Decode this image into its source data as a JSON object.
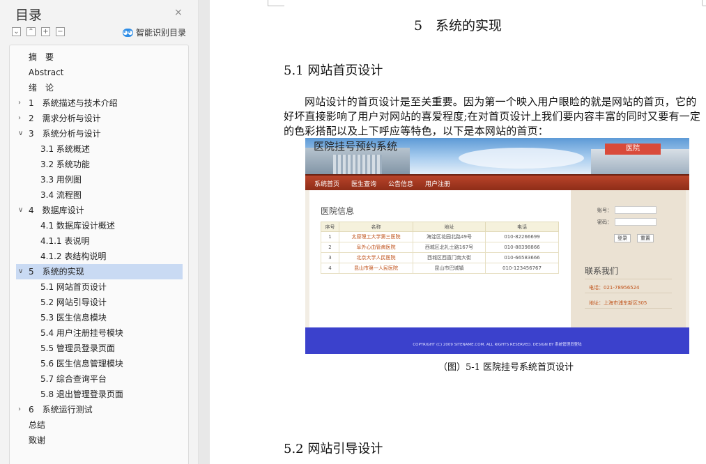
{
  "toc": {
    "title": "目录",
    "close_icon": "×",
    "tool_icons": [
      "collapse-all",
      "expand-all",
      "add-heading",
      "remove-heading"
    ],
    "smart_label": "智能识别目录",
    "items": [
      {
        "label": "摘　要",
        "level": 0,
        "toggle": ""
      },
      {
        "label": "Abstract",
        "level": 0,
        "toggle": ""
      },
      {
        "label": "绪　论",
        "level": 0,
        "toggle": ""
      },
      {
        "label": "1　系统描述与技术介绍",
        "level": 0,
        "toggle": ">"
      },
      {
        "label": "2　需求分析与设计",
        "level": 0,
        "toggle": ">"
      },
      {
        "label": "3　系统分析与设计",
        "level": 0,
        "toggle": "v"
      },
      {
        "label": "3.1  系统概述",
        "level": 1,
        "toggle": ""
      },
      {
        "label": "3.2   系统功能",
        "level": 1,
        "toggle": ""
      },
      {
        "label": "3.3  用例图",
        "level": 1,
        "toggle": ""
      },
      {
        "label": "3.4  流程图",
        "level": 1,
        "toggle": ""
      },
      {
        "label": "4　数据库设计",
        "level": 0,
        "toggle": "v"
      },
      {
        "label": "4.1  数据库设计概述",
        "level": 1,
        "toggle": ""
      },
      {
        "label": "4.1.1  表说明",
        "level": 1,
        "toggle": ""
      },
      {
        "label": "4.1.2  表结构说明",
        "level": 1,
        "toggle": ""
      },
      {
        "label": "5　系统的实现",
        "level": 0,
        "toggle": "v",
        "active": true
      },
      {
        "label": "5.1  网站首页设计",
        "level": 1,
        "toggle": ""
      },
      {
        "label": "5.2  网站引导设计",
        "level": 1,
        "toggle": ""
      },
      {
        "label": "5.3 医生信息模块",
        "level": 1,
        "toggle": ""
      },
      {
        "label": "5.4  用户注册挂号模块",
        "level": 1,
        "toggle": ""
      },
      {
        "label": "5.5  管理员登录页面",
        "level": 1,
        "toggle": ""
      },
      {
        "label": "5.6  医生信息管理模块",
        "level": 1,
        "toggle": ""
      },
      {
        "label": "5.7 综合查询平台",
        "level": 1,
        "toggle": ""
      },
      {
        "label": "5.8 退出管理登录页面",
        "level": 1,
        "toggle": ""
      },
      {
        "label": "6　系统运行测试",
        "level": 0,
        "toggle": ">"
      },
      {
        "label": "总结",
        "level": 0,
        "toggle": ""
      },
      {
        "label": "致谢",
        "level": 0,
        "toggle": ""
      }
    ]
  },
  "document": {
    "chapter_title": "5　系统的实现",
    "section_51": "5.1  网站首页设计",
    "paragraph": "网站设计的首页设计是至关重要。因为第一个映入用户眼睑的就是网站的首页，它的好坏直接影响了用户对网站的喜爱程度;在对首页设计上我们要内容丰富的同时又要有一定的色彩搭配以及上下呼应等特色，以下是本网站的首页：",
    "caption": "（图）5-1 医院挂号系统首页设计",
    "section_52": "5.2  网站引导设计"
  },
  "screenshot": {
    "brand": "医院挂号预约系统",
    "banner_sign": "医院",
    "nav": [
      "系统首页",
      "医生查询",
      "公告信息",
      "用户注册"
    ],
    "info_title": "医院信息",
    "table_headers": [
      "序号",
      "名称",
      "地址",
      "电话"
    ],
    "table_rows": [
      [
        "1",
        "太原理工大学第三医院",
        "海淀区花园北路49号",
        "010-82266699"
      ],
      [
        "2",
        "阜外心血管病医院",
        "西城区北礼士路167号",
        "010-88398866"
      ],
      [
        "3",
        "北京大学人民医院",
        "西城区西直门南大街",
        "010-66583666"
      ],
      [
        "4",
        "昆山市第一人民医院",
        "昆山市巴城镇",
        "010-123456767"
      ]
    ],
    "login_user_label": "账号：",
    "login_pass_label": "密码：",
    "login_button": "登录",
    "reset_button": "重置",
    "contact_title": "联系我们",
    "contact_phone": "电话：021-78956524",
    "contact_address": "地址：上海市浦东新区305",
    "footer": "COPYRIGHT (C) 2009 SITENAME.COM. ALL RIGHTS RESERVED. DESIGN BY 系统管理员登陆"
  }
}
